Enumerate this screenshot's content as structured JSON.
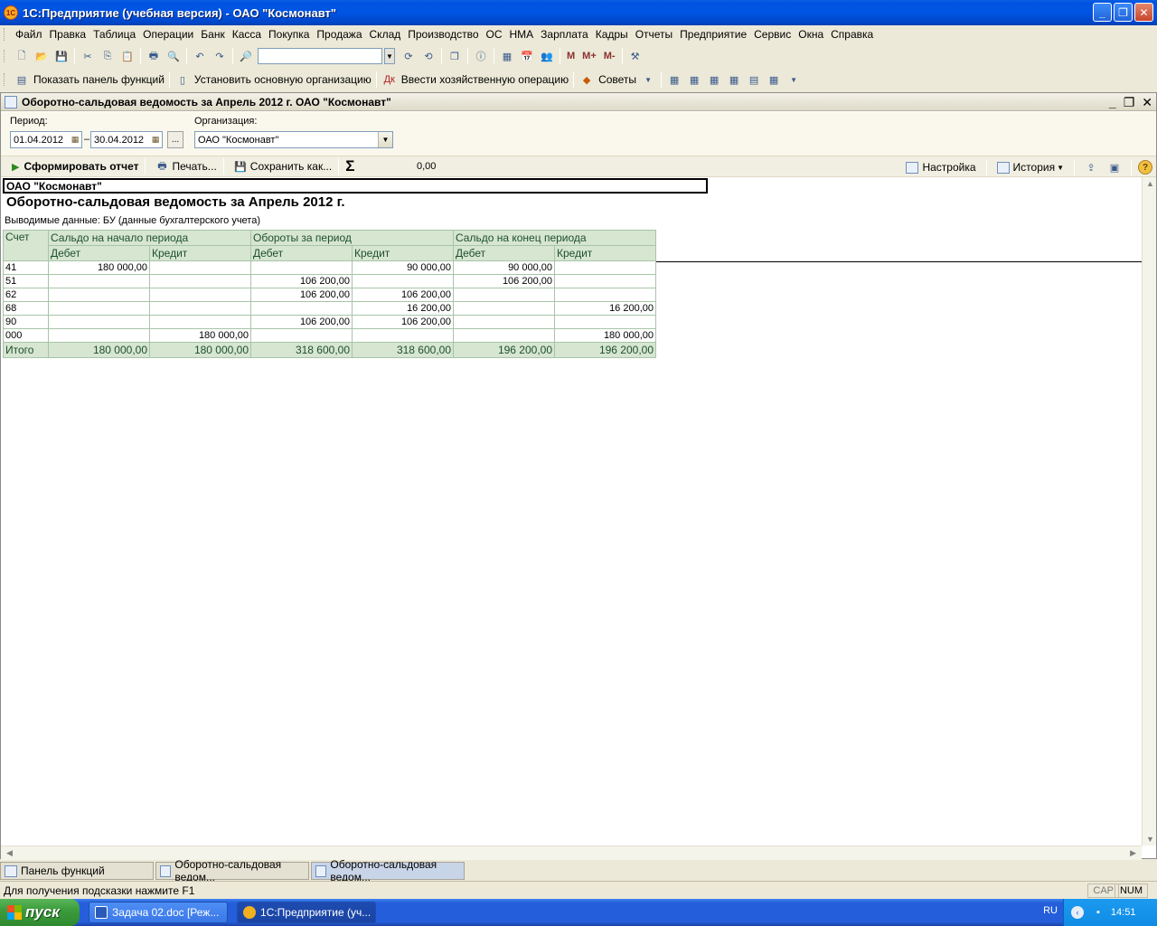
{
  "window": {
    "title": "1С:Предприятие (учебная версия) - ОАО \"Космонавт\"",
    "app_icon": "1С"
  },
  "menu": [
    "Файл",
    "Правка",
    "Таблица",
    "Операции",
    "Банк",
    "Касса",
    "Покупка",
    "Продажа",
    "Склад",
    "Производство",
    "ОС",
    "НМА",
    "Зарплата",
    "Кадры",
    "Отчеты",
    "Предприятие",
    "Сервис",
    "Окна",
    "Справка"
  ],
  "toolbar2": {
    "show_panel": "Показать панель функций",
    "set_org": "Установить основную организацию",
    "enter_op": "Ввести хозяйственную операцию",
    "tips": "Советы"
  },
  "toolbar1": {
    "m": "M",
    "mplus": "M+",
    "mminus": "M-"
  },
  "doc": {
    "title": "Оборотно-сальдовая ведомость за Апрель 2012 г. ОАО \"Космонавт\"",
    "period_label": "Период:",
    "date_from": "01.04.2012",
    "dash": "–",
    "date_to": "30.04.2012",
    "ellipsis": "...",
    "org_label": "Организация:",
    "org_value": "ОАО \"Космонавт\"",
    "cmd_generate": "Сформировать отчет",
    "cmd_print": "Печать...",
    "cmd_save": "Сохранить как...",
    "sigma": "Σ",
    "sum_value": "0,00",
    "cmd_settings": "Настройка",
    "cmd_history": "История",
    "help": "?"
  },
  "report": {
    "org": "ОАО \"Космонавт\"",
    "title": "Оборотно-сальдовая ведомость за Апрель 2012 г.",
    "subtitle": "Выводимые данные:  БУ (данные бухгалтерского учета)",
    "headers": {
      "account": "Счет",
      "start": "Сальдо на начало периода",
      "turnover": "Обороты за период",
      "end": "Сальдо на конец периода",
      "debit": "Дебет",
      "credit": "Кредит"
    },
    "rows": [
      [
        "41",
        "180 000,00",
        "",
        "",
        "90 000,00",
        "90 000,00",
        ""
      ],
      [
        "51",
        "",
        "",
        "106 200,00",
        "",
        "106 200,00",
        ""
      ],
      [
        "62",
        "",
        "",
        "106 200,00",
        "106 200,00",
        "",
        ""
      ],
      [
        "68",
        "",
        "",
        "",
        "16 200,00",
        "",
        "16 200,00"
      ],
      [
        "90",
        "",
        "",
        "106 200,00",
        "106 200,00",
        "",
        ""
      ],
      [
        "000",
        "",
        "180 000,00",
        "",
        "",
        "",
        "180 000,00"
      ]
    ],
    "total": [
      "Итого",
      "180 000,00",
      "180 000,00",
      "318 600,00",
      "318 600,00",
      "196 200,00",
      "196 200,00"
    ]
  },
  "tabs": [
    {
      "label": "Панель функций",
      "active": false
    },
    {
      "label": "Оборотно-сальдовая ведом...",
      "active": false
    },
    {
      "label": "Оборотно-сальдовая ведом...",
      "active": true
    }
  ],
  "status": {
    "hint": "Для получения подсказки нажмите F1",
    "cap": "CAP",
    "num": "NUM"
  },
  "taskbar": {
    "start": "пуск",
    "tasks": [
      {
        "label": "Задача 02.doc [Реж...",
        "active": false
      },
      {
        "label": "1С:Предприятие (уч...",
        "active": true
      }
    ],
    "lang": "RU",
    "time": "14:51"
  }
}
